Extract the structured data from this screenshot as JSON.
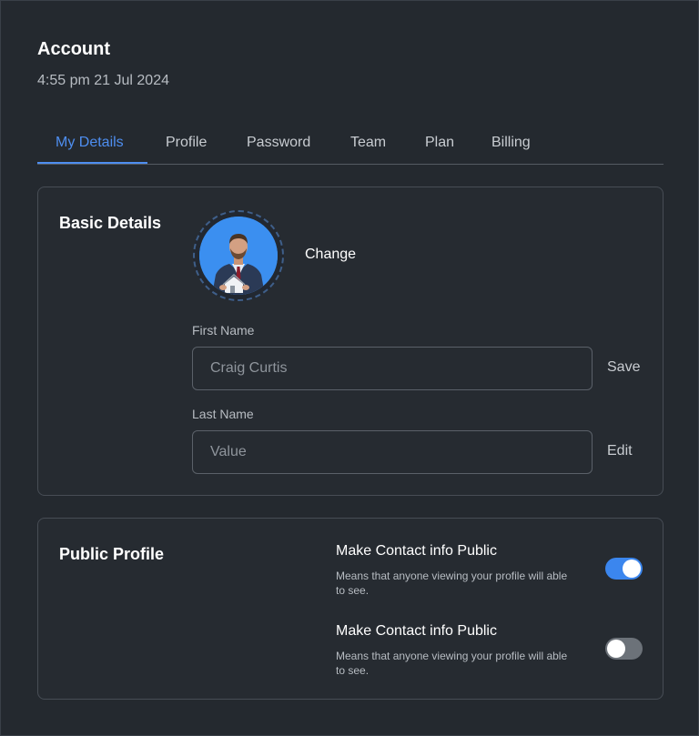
{
  "header": {
    "title": "Account",
    "datetime": "4:55 pm 21 Jul 2024"
  },
  "tabs": [
    {
      "label": "My Details",
      "active": true
    },
    {
      "label": "Profile",
      "active": false
    },
    {
      "label": "Password",
      "active": false
    },
    {
      "label": "Team",
      "active": false
    },
    {
      "label": "Plan",
      "active": false
    },
    {
      "label": "Billing",
      "active": false
    }
  ],
  "basic_details": {
    "title": "Basic Details",
    "change_label": "Change",
    "first_name": {
      "label": "First Name",
      "value": "Craig Curtis",
      "action": "Save"
    },
    "last_name": {
      "label": "Last Name",
      "placeholder": "Value",
      "action": "Edit"
    }
  },
  "public_profile": {
    "title": "Public Profile",
    "toggles": [
      {
        "title": "Make Contact info Public",
        "description": "Means that anyone viewing your profile will able to see.",
        "on": true
      },
      {
        "title": "Make Contact info Public",
        "description": "Means that anyone viewing your profile will able to see.",
        "on": false
      }
    ]
  },
  "colors": {
    "background": "#24292f",
    "accent": "#4e8ef0",
    "toggle_on": "#3b86ee",
    "toggle_off": "#6c7279"
  }
}
